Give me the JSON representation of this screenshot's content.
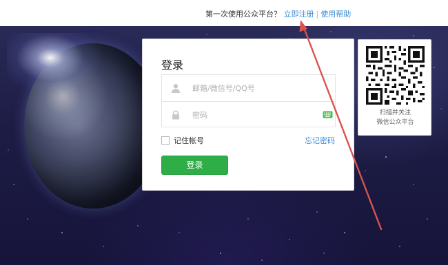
{
  "topbar": {
    "prompt": "第一次使用公众平台？",
    "register_link": "立即注册",
    "separator": "|",
    "help_link": "使用帮助"
  },
  "login": {
    "title": "登录",
    "username_placeholder": "邮箱/微信号/QQ号",
    "password_placeholder": "密码",
    "remember_label": "记住帐号",
    "remember_checked": false,
    "forgot_link": "忘记密码",
    "submit_label": "登录"
  },
  "qr_panel": {
    "caption_line1": "扫描并关注",
    "caption_line2": "微信公众平台"
  },
  "colors": {
    "link": "#3b8bd3",
    "primary_button": "#2fae48",
    "annotation_arrow": "#d9534f"
  }
}
